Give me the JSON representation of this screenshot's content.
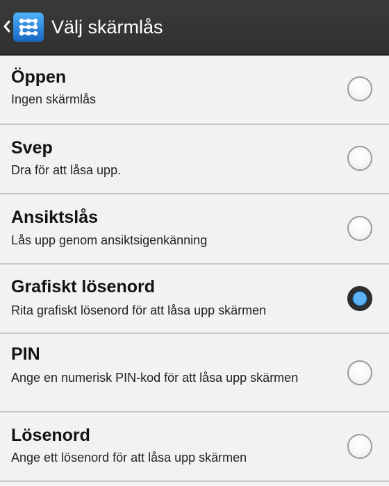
{
  "header": {
    "title": "Välj skärmlås",
    "back_icon": "chevron-left-icon",
    "app_icon": "pattern-grid-icon"
  },
  "options": [
    {
      "title": "Öppen",
      "subtitle": "Ingen skärmlås",
      "selected": false
    },
    {
      "title": "Svep",
      "subtitle": "Dra för att låsa upp.",
      "selected": false
    },
    {
      "title": "Ansiktslås",
      "subtitle": "Lås upp genom ansiktsigenkänning",
      "selected": false
    },
    {
      "title": "Grafiskt lösenord",
      "subtitle": "Rita grafiskt lösenord för att låsa upp skärmen",
      "selected": true
    },
    {
      "title": "PIN",
      "subtitle": "Ange en numerisk PIN-kod för att låsa upp skärmen",
      "selected": false
    },
    {
      "title": "Lösenord",
      "subtitle": "Ange ett lösenord för att låsa upp skärmen",
      "selected": false
    }
  ],
  "colors": {
    "action_bar": "#333333",
    "accent": "#5cb3f5",
    "background": "#f2f2f2"
  }
}
